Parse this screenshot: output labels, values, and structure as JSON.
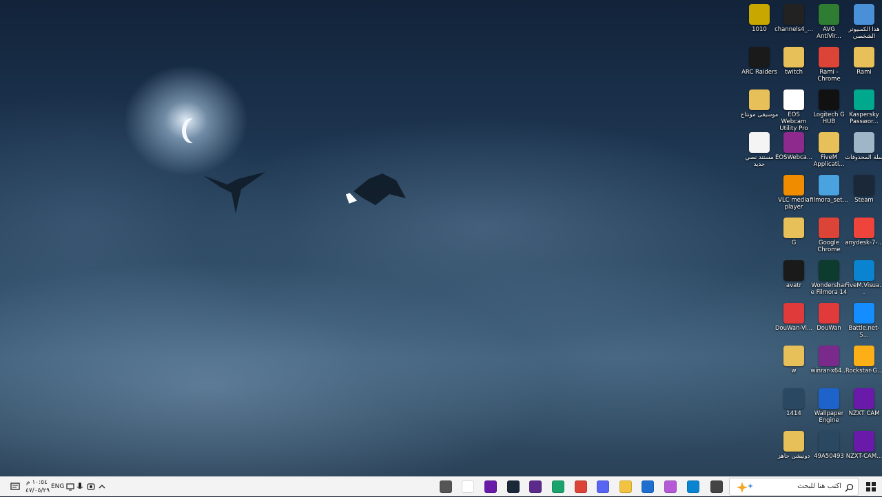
{
  "desktop": {
    "icons": [
      {
        "label": "هذا الكمبيوتر الشخصي",
        "name": "this-pc",
        "color": "#4a90d9"
      },
      {
        "label": "AVG AntiVir...",
        "name": "avg-antivirus",
        "color": "#2e7d32"
      },
      {
        "label": "channels4_...",
        "name": "channels4",
        "color": "#222222"
      },
      {
        "label": "1010",
        "name": "file-1010",
        "color": "#c8a800"
      },
      {
        "label": "Rami",
        "name": "folder-rami",
        "color": "#e8c05a"
      },
      {
        "label": "Rami - Chrome",
        "name": "rami-chrome",
        "color": "#db4437"
      },
      {
        "label": "twitch",
        "name": "folder-twitch",
        "color": "#e8c05a"
      },
      {
        "label": "ARC Raiders",
        "name": "arc-raiders",
        "color": "#1a1a1a"
      },
      {
        "label": "Kaspersky Passwor...",
        "name": "kaspersky-password",
        "color": "#00a88e"
      },
      {
        "label": "Logitech G HUB",
        "name": "logitech-g-hub",
        "color": "#111111"
      },
      {
        "label": "EOS Webcam Utility Pro",
        "name": "eos-webcam-utility",
        "color": "#ffffff"
      },
      {
        "label": "موسيقى مونتاج",
        "name": "folder-music-montage",
        "color": "#e8c05a"
      },
      {
        "label": "سلة المحذوفات",
        "name": "recycle-bin",
        "color": "#9fb5c8"
      },
      {
        "label": "FiveM Applicati...",
        "name": "fivem-application",
        "color": "#e8c05a"
      },
      {
        "label": "EOSWebca...",
        "name": "eoswebcam-installer",
        "color": "#8e2a8e"
      },
      {
        "label": "مستند نصي جديد",
        "name": "new-text-document",
        "color": "#f4f4f4"
      },
      {
        "label": "Steam",
        "name": "steam",
        "color": "#1b2838"
      },
      {
        "label": "filmora_set...",
        "name": "filmora-setup",
        "color": "#4aa3df"
      },
      {
        "label": "VLC media player",
        "name": "vlc-media-player",
        "color": "#f08c00"
      },
      {
        "label": "anydesk-7-...",
        "name": "anydesk",
        "color": "#ef443b"
      },
      {
        "label": "Google Chrome",
        "name": "google-chrome",
        "color": "#db4437"
      },
      {
        "label": "G",
        "name": "file-g",
        "color": "#e8c05a"
      },
      {
        "label": "FiveM.Visua...",
        "name": "fivem-visual",
        "color": "#0a84d0"
      },
      {
        "label": "Wondershare Filmora 14",
        "name": "wondershare-filmora",
        "color": "#0d3b2e"
      },
      {
        "label": "avatr",
        "name": "avatr",
        "color": "#1a1a1a"
      },
      {
        "label": "Battle.net-S...",
        "name": "battle-net-setup",
        "color": "#148eff"
      },
      {
        "label": "DouWan",
        "name": "douwan",
        "color": "#e03a3a"
      },
      {
        "label": "DouWan-Vi...",
        "name": "douwan-vi",
        "color": "#e03a3a"
      },
      {
        "label": "Rockstar-G...",
        "name": "rockstar-games",
        "color": "#fcaf17"
      },
      {
        "label": "winrar-x64...",
        "name": "winrar",
        "color": "#7a2a8a"
      },
      {
        "label": "w",
        "name": "file-w",
        "color": "#e8c05a"
      },
      {
        "label": "NZXT CAM",
        "name": "nzxt-cam",
        "color": "#6a1aa8"
      },
      {
        "label": "Wallpaper Engine",
        "name": "wallpaper-engine",
        "color": "#1d63c9"
      },
      {
        "label": "1414",
        "name": "file-1414",
        "color": "#2b4862"
      },
      {
        "label": "NZXT-CAM...",
        "name": "nzxt-cam-installer",
        "color": "#6a1aa8"
      },
      {
        "label": "49A50493",
        "name": "file-49a50493",
        "color": "#2b4862"
      },
      {
        "label": "دونيشن جاهز",
        "name": "folder-donation",
        "color": "#e8c05a"
      }
    ]
  },
  "taskbar": {
    "search_placeholder": "اكتب هنا للبحث",
    "tray": {
      "language": "ENG",
      "time": "١٠:٥٤ م",
      "date": "٤٧/٠٥/٢٩"
    },
    "apps": [
      {
        "name": "taskbar-task-view",
        "color": "#555555"
      },
      {
        "name": "taskbar-notepad",
        "color": "#ffffff"
      },
      {
        "name": "taskbar-nzxt",
        "color": "#6a1aa8"
      },
      {
        "name": "taskbar-steam",
        "color": "#1b2838"
      },
      {
        "name": "taskbar-obs",
        "color": "#5b2a8a"
      },
      {
        "name": "taskbar-app-green",
        "color": "#1aa36b"
      },
      {
        "name": "taskbar-chrome",
        "color": "#db4437"
      },
      {
        "name": "taskbar-discord",
        "color": "#5865f2"
      },
      {
        "name": "taskbar-file-explorer",
        "color": "#f2c341"
      },
      {
        "name": "taskbar-store",
        "color": "#1f6fcf"
      },
      {
        "name": "taskbar-copilot",
        "color": "#b55ad6"
      },
      {
        "name": "taskbar-edge",
        "color": "#0a84d0"
      },
      {
        "name": "taskbar-multitask",
        "color": "#444444"
      }
    ]
  }
}
